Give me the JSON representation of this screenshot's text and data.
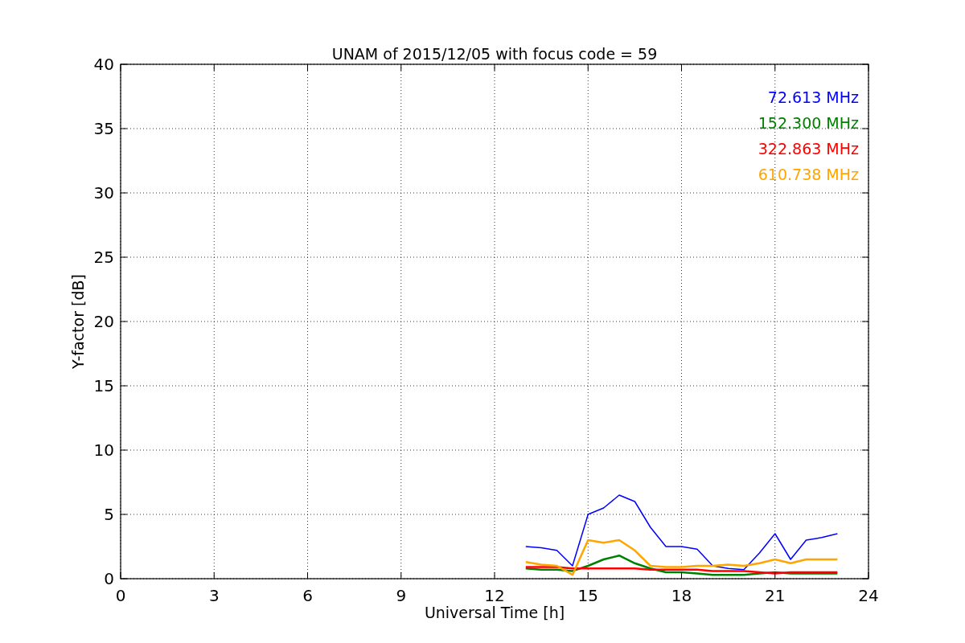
{
  "chart_data": {
    "type": "line",
    "title": "UNAM of 2015/12/05 with focus code = 59",
    "xlabel": "Universal Time [h]",
    "ylabel": "Y-factor [dB]",
    "x": [
      13,
      13.5,
      14,
      14.5,
      15,
      15.5,
      16,
      16.5,
      17,
      17.5,
      18,
      18.5,
      19,
      19.5,
      20,
      20.5,
      21,
      21.5,
      22,
      22.5,
      23
    ],
    "series": [
      {
        "name": "72.613 MHz",
        "color": "#0000ff",
        "values": [
          2.5,
          2.4,
          2.2,
          1.0,
          5.0,
          5.5,
          6.5,
          6.0,
          4.0,
          2.5,
          2.5,
          2.3,
          1.0,
          0.8,
          0.7,
          2.0,
          3.5,
          1.5,
          3.0,
          3.2,
          3.5
        ]
      },
      {
        "name": "152.300 MHz",
        "color": "#008000",
        "values": [
          0.8,
          0.7,
          0.7,
          0.6,
          1.0,
          1.5,
          1.8,
          1.2,
          0.8,
          0.5,
          0.5,
          0.4,
          0.3,
          0.3,
          0.3,
          0.4,
          0.5,
          0.4,
          0.4,
          0.4,
          0.4
        ]
      },
      {
        "name": "322.863 MHz",
        "color": "#ff0000",
        "values": [
          0.9,
          0.9,
          0.9,
          0.8,
          0.8,
          0.8,
          0.8,
          0.8,
          0.7,
          0.7,
          0.7,
          0.7,
          0.6,
          0.6,
          0.6,
          0.5,
          0.4,
          0.5,
          0.5,
          0.5,
          0.5
        ]
      },
      {
        "name": "610.738 MHz",
        "color": "#ffa500",
        "values": [
          1.3,
          1.1,
          1.0,
          0.3,
          3.0,
          2.8,
          3.0,
          2.2,
          1.0,
          0.9,
          0.9,
          1.0,
          1.0,
          1.1,
          1.0,
          1.2,
          1.5,
          1.2,
          1.5,
          1.5,
          1.5
        ]
      }
    ],
    "grid": true,
    "xlim": [
      0,
      24
    ],
    "ylim": [
      0,
      40
    ],
    "xticks": [
      0,
      3,
      6,
      9,
      12,
      15,
      18,
      21,
      24
    ],
    "yticks": [
      0,
      5,
      10,
      15,
      20,
      25,
      30,
      35,
      40
    ]
  }
}
